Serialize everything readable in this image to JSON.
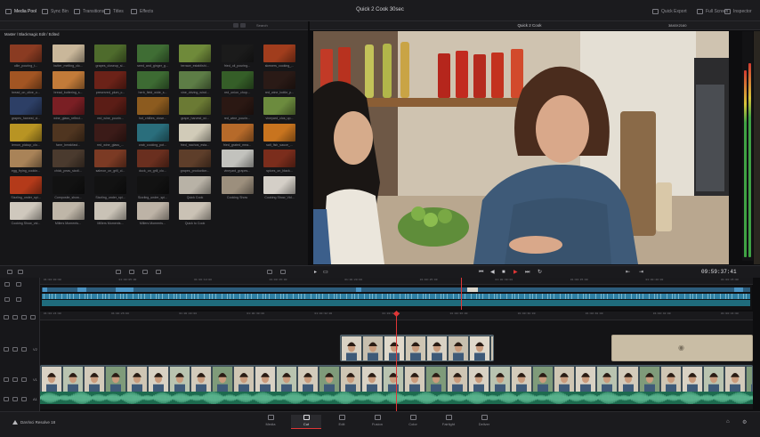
{
  "topbar": {
    "items": [
      {
        "label": "Media Pool",
        "icon": "media-pool-icon",
        "active": true
      },
      {
        "label": "Sync Bin",
        "icon": "sync-bin-icon",
        "active": false
      },
      {
        "label": "Transitions",
        "icon": "transitions-icon",
        "active": false
      },
      {
        "label": "Titles",
        "icon": "titles-icon",
        "active": false
      },
      {
        "label": "Effects",
        "icon": "effects-icon",
        "active": false
      }
    ],
    "project_title": "Quick 2 Cook 30sec",
    "right_items": [
      {
        "label": "Quick Export",
        "icon": "export-icon"
      },
      {
        "label": "Full Screen",
        "icon": "fullscreen-icon"
      },
      {
        "label": "Inspector",
        "icon": "inspector-icon"
      }
    ]
  },
  "media_pool": {
    "search_placeholder": "Search",
    "breadcrumb": "Master / Blackmagic Edit / Edited",
    "clips": [
      {
        "name": "ollie_pouring_t...",
        "color": "#8a3b22"
      },
      {
        "name": "butter_melting_clo...",
        "color": "#c9b79a"
      },
      {
        "name": "grapes_closeup_sl...",
        "color": "#4e6b2c"
      },
      {
        "name": "seed_and_ginger_g...",
        "color": "#3f6d34"
      },
      {
        "name": "terrace_establishi...",
        "color": "#6f8a3a"
      },
      {
        "name": "fried_oil_pouring...",
        "color": "#1b1b1b"
      },
      {
        "name": "skewers_cooking_...",
        "color": "#a13d1d"
      },
      {
        "name": "bread_on_olive_o...",
        "color": "#a25523"
      },
      {
        "name": "bread_buttering_s...",
        "color": "#c27b39"
      },
      {
        "name": "preserved_plum_c...",
        "color": "#6b2218"
      },
      {
        "name": "herb_field_wide_s...",
        "color": "#3d6b33"
      },
      {
        "name": "vine_driving_wind...",
        "color": "#5d7d46"
      },
      {
        "name": "red_onion_chop...",
        "color": "#355e28"
      },
      {
        "name": "red_wine_bottle_p...",
        "color": "#2a1a16"
      },
      {
        "name": "grapes_harvest_cl...",
        "color": "#2d3f66"
      },
      {
        "name": "wine_glass_reflect...",
        "color": "#7a1f24"
      },
      {
        "name": "red_wine_pourin...",
        "color": "#5b1d16"
      },
      {
        "name": "hot_chillies_close...",
        "color": "#8c5b1f"
      },
      {
        "name": "grape_harvest_wi...",
        "color": "#6b7a34"
      },
      {
        "name": "red_wine_pourin...",
        "color": "#2b1813"
      },
      {
        "name": "vineyard_clos_up...",
        "color": "#6c8b3e"
      },
      {
        "name": "lemon_pickup_clo...",
        "color": "#b89423"
      },
      {
        "name": "farm_breakfast...",
        "color": "#4f3520"
      },
      {
        "name": "red_wine_glass_...",
        "color": "#3b1b18"
      },
      {
        "name": "crab_cooking_pot...",
        "color": "#2a6e7c"
      },
      {
        "name": "fried_nachos_esta...",
        "color": "#d1cbb8"
      },
      {
        "name": "fried_grated_mea...",
        "color": "#b66a2a"
      },
      {
        "name": "salt_fish_sauce_...",
        "color": "#c8741f"
      },
      {
        "name": "egg_frying_cookin...",
        "color": "#a98358"
      },
      {
        "name": "chick_peas_sizzli...",
        "color": "#4a3a2e"
      },
      {
        "name": "salmon_on_grill_cl...",
        "color": "#7b3a24"
      },
      {
        "name": "duck_on_grill_clo...",
        "color": "#6a2f1f"
      },
      {
        "name": "grapes_production...",
        "color": "#5e3e2a"
      },
      {
        "name": "vineyard_grapes...",
        "color": "#c2c2bd"
      },
      {
        "name": "spices_on_black...",
        "color": "#7b2d1c"
      },
      {
        "name": "Sizzling_under_spi...",
        "color": "#b43a1a"
      },
      {
        "name": "Composite_show...",
        "color": "#121212"
      },
      {
        "name": "Sizzling_under_spi...",
        "color": "#121212"
      },
      {
        "name": "Sizzling_under_spi...",
        "color": "#121212"
      },
      {
        "name": "Quick Cook",
        "color": "#b8b2a6"
      },
      {
        "name": "Cooking Show",
        "color": "#9c8f7d"
      },
      {
        "name": "Cooking Show_Vid...",
        "color": "#d4cfc7"
      },
      {
        "name": "Cooking Show_vid...",
        "color": "#cfc8bd"
      },
      {
        "name": "Millers Moments...",
        "color": "#bfb6a8"
      },
      {
        "name": "Millers Moments...",
        "color": "#c9c2b6"
      },
      {
        "name": "Millers Moments...",
        "color": "#bdb3a6"
      },
      {
        "name": "Quick to Cook",
        "color": "#cac2b5"
      }
    ]
  },
  "viewer": {
    "clip_name": "Quick 2 Cook",
    "resolution": "3840X2160",
    "timecode": "09:59:37:41"
  },
  "timeline": {
    "ruler_ticks": [
      "01:00:00:00",
      "01:00:05:00",
      "01:00:10:00",
      "01:00:15:00",
      "01:00:20:00",
      "01:00:25:00",
      "01:00:30:00",
      "01:00:35:00",
      "01:00:40:00",
      "01:00:45:00"
    ],
    "lower_ticks": [
      "01:00:24:00",
      "01:00:26:00",
      "01:00:28:00",
      "01:00:30:00",
      "01:00:32:00",
      "01:00:34:00",
      "01:00:36:00",
      "01:00:38:00",
      "01:00:40:00",
      "01:00:42:00",
      "01:00:44:00"
    ],
    "track_labels": [
      "V2",
      "V1",
      "A1"
    ],
    "playhead_fraction": 0.52
  },
  "bottombar": {
    "brand": "DaVinci Resolve 18",
    "pages": [
      {
        "label": "Media",
        "icon": "media-page-icon",
        "active": false
      },
      {
        "label": "Cut",
        "icon": "cut-page-icon",
        "active": true
      },
      {
        "label": "Edit",
        "icon": "edit-page-icon",
        "active": false
      },
      {
        "label": "Fusion",
        "icon": "fusion-page-icon",
        "active": false
      },
      {
        "label": "Color",
        "icon": "color-page-icon",
        "active": false
      },
      {
        "label": "Fairlight",
        "icon": "fairlight-page-icon",
        "active": false
      },
      {
        "label": "Deliver",
        "icon": "deliver-page-icon",
        "active": false
      }
    ]
  }
}
